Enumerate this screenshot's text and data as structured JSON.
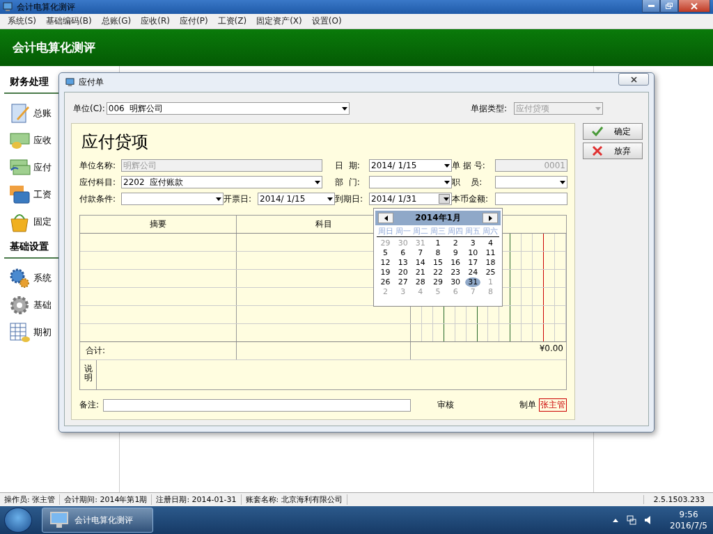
{
  "window": {
    "title": "会计电算化测评"
  },
  "menu": [
    {
      "label": "系统(S)"
    },
    {
      "label": "基础编码(B)"
    },
    {
      "label": "总账(G)"
    },
    {
      "label": "应收(R)"
    },
    {
      "label": "应付(P)"
    },
    {
      "label": "工资(Z)"
    },
    {
      "label": "固定资产(X)"
    },
    {
      "label": "设置(O)"
    }
  ],
  "header": {
    "title": "会计电算化测评"
  },
  "sidebar": [
    {
      "title": "财务处理",
      "items": [
        {
          "label": "总账",
          "kind": "notebook"
        },
        {
          "label": "应收",
          "kind": "coins"
        },
        {
          "label": "应付",
          "kind": "bills"
        },
        {
          "label": "工资",
          "kind": "cards"
        },
        {
          "label": "固定",
          "kind": "basket"
        }
      ]
    },
    {
      "title": "基础设置",
      "items": [
        {
          "label": "系统",
          "kind": "gears"
        },
        {
          "label": "基础",
          "kind": "gear"
        },
        {
          "label": "期初",
          "kind": "sheet"
        }
      ]
    }
  ],
  "dialog": {
    "title": "应付单",
    "unit": {
      "label": "单位(C):",
      "value": "006  明辉公司"
    },
    "doc_type": {
      "label": "单据类型:",
      "value": "应付贷项",
      "disabled": true
    },
    "buttons": [
      {
        "label": "确定",
        "kind": "ok"
      },
      {
        "label": "放弃",
        "kind": "cancel"
      }
    ],
    "form_title": "应付贷项",
    "fields": [
      {
        "label": "单位名称:",
        "value": "明辉公司",
        "kind": "text",
        "disabled": true
      },
      {
        "label": "日  期:",
        "value": "2014/ 1/15",
        "kind": "combo",
        "disabled": false,
        "open": false
      },
      {
        "label": "单 据 号:",
        "value": "0001",
        "kind": "number",
        "disabled": true
      },
      {
        "label": "应付科目:",
        "value": "2202  应付账款",
        "kind": "combo",
        "disabled": false,
        "open": false
      },
      {
        "label": "部  门:",
        "kind": "combo",
        "disabled": false,
        "open": false
      },
      {
        "label": "职    员:",
        "kind": "combo",
        "disabled": false,
        "open": false
      },
      {
        "label": "付款条件:",
        "kind": "combo",
        "disabled": false,
        "open": false
      },
      {
        "label": "开票日:",
        "value": "2014/ 1/15",
        "kind": "combo",
        "disabled": false,
        "open": false
      },
      {
        "label": "到期日:",
        "value": "2014/ 1/31",
        "kind": "combo",
        "disabled": false,
        "open": true
      },
      {
        "label": "本币金额:",
        "kind": "text",
        "disabled": false
      }
    ],
    "table": {
      "columns": [
        "摘要",
        "科目"
      ],
      "row_count_rows": [
        {},
        {},
        {},
        {},
        {},
        {}
      ],
      "total_label": "合计:",
      "total_amount": "¥0.00",
      "note_label": "说明"
    },
    "remark_label": "备注:",
    "review_label": "审核",
    "maker_label": "制单",
    "maker": "张主管",
    "calendar": {
      "title": "2014年1月",
      "weekdays": [
        "周日",
        "周一",
        "周二",
        "周三",
        "周四",
        "周五",
        "周六"
      ],
      "days": [
        {
          "text": "29",
          "in_month": false,
          "selected": false
        },
        {
          "text": "30",
          "in_month": false,
          "selected": false
        },
        {
          "text": "31",
          "in_month": false,
          "selected": false
        },
        {
          "text": "1",
          "in_month": true,
          "selected": false
        },
        {
          "text": "2",
          "in_month": true,
          "selected": false
        },
        {
          "text": "3",
          "in_month": true,
          "selected": false
        },
        {
          "text": "4",
          "in_month": true,
          "selected": false
        },
        {
          "text": "5",
          "in_month": true,
          "selected": false
        },
        {
          "text": "6",
          "in_month": true,
          "selected": false
        },
        {
          "text": "7",
          "in_month": true,
          "selected": false
        },
        {
          "text": "8",
          "in_month": true,
          "selected": false
        },
        {
          "text": "9",
          "in_month": true,
          "selected": false
        },
        {
          "text": "10",
          "in_month": true,
          "selected": false
        },
        {
          "text": "11",
          "in_month": true,
          "selected": false
        },
        {
          "text": "12",
          "in_month": true,
          "selected": false
        },
        {
          "text": "13",
          "in_month": true,
          "selected": false
        },
        {
          "text": "14",
          "in_month": true,
          "selected": false
        },
        {
          "text": "15",
          "in_month": true,
          "selected": false
        },
        {
          "text": "16",
          "in_month": true,
          "selected": false
        },
        {
          "text": "17",
          "in_month": true,
          "selected": false
        },
        {
          "text": "18",
          "in_month": true,
          "selected": false
        },
        {
          "text": "19",
          "in_month": true,
          "selected": false
        },
        {
          "text": "20",
          "in_month": true,
          "selected": false
        },
        {
          "text": "21",
          "in_month": true,
          "selected": false
        },
        {
          "text": "22",
          "in_month": true,
          "selected": false
        },
        {
          "text": "23",
          "in_month": true,
          "selected": false
        },
        {
          "text": "24",
          "in_month": true,
          "selected": false
        },
        {
          "text": "25",
          "in_month": true,
          "selected": false
        },
        {
          "text": "26",
          "in_month": true,
          "selected": false
        },
        {
          "text": "27",
          "in_month": true,
          "selected": false
        },
        {
          "text": "28",
          "in_month": true,
          "selected": false
        },
        {
          "text": "29",
          "in_month": true,
          "selected": false
        },
        {
          "text": "30",
          "in_month": true,
          "selected": false
        },
        {
          "text": "31",
          "in_month": true,
          "selected": true
        },
        {
          "text": "1",
          "in_month": false,
          "selected": false
        },
        {
          "text": "2",
          "in_month": false,
          "selected": false
        },
        {
          "text": "3",
          "in_month": false,
          "selected": false
        },
        {
          "text": "4",
          "in_month": false,
          "selected": false
        },
        {
          "text": "5",
          "in_month": false,
          "selected": false
        },
        {
          "text": "6",
          "in_month": false,
          "selected": false
        },
        {
          "text": "7",
          "in_month": false,
          "selected": false
        },
        {
          "text": "8",
          "in_month": false,
          "selected": false
        }
      ]
    }
  },
  "status_bar": {
    "items": [
      "操作员: 张主管",
      "会计期间: 2014年第1期",
      "注册日期: 2014-01-31",
      "账套名称: 北京海利有限公司"
    ],
    "version": "2.5.1503.233"
  },
  "taskbar": {
    "app": "会计电算化测评",
    "time": "9:56",
    "date": "2016/7/5"
  }
}
